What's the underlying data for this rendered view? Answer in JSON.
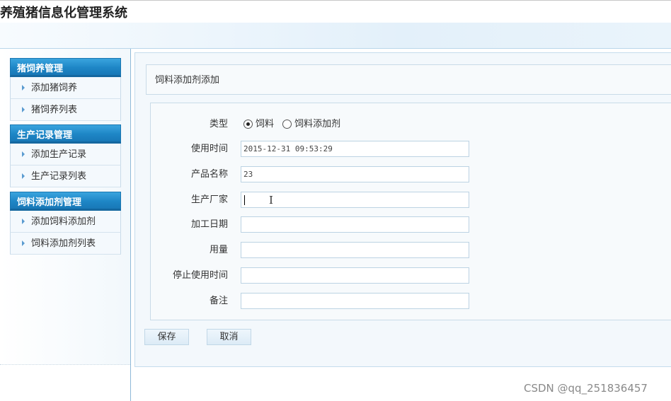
{
  "app": {
    "title": "养殖猪信息化管理系统"
  },
  "sidebar": {
    "groups": [
      {
        "title": "猪饲养管理",
        "items": [
          "添加猪饲养",
          "猪饲养列表"
        ]
      },
      {
        "title": "生产记录管理",
        "items": [
          "添加生产记录",
          "生产记录列表"
        ]
      },
      {
        "title": "饲料添加剂管理",
        "items": [
          "添加饲料添加剂",
          "饲料添加剂列表"
        ]
      }
    ]
  },
  "page": {
    "breadcrumb": "饲料添加剂添加",
    "form": {
      "type_label": "类型",
      "type_options": [
        "饲料",
        "饲料添加剂"
      ],
      "type_selected": "饲料",
      "use_time_label": "使用时间",
      "use_time_value": "2015-12-31 09:53:29",
      "product_name_label": "产品名称",
      "product_name_value": "23",
      "manufacturer_label": "生产厂家",
      "manufacturer_value": "",
      "process_date_label": "加工日期",
      "process_date_value": "",
      "amount_label": "用量",
      "amount_value": "",
      "stop_time_label": "停止使用时间",
      "stop_time_value": "",
      "remark_label": "备注",
      "remark_value": ""
    },
    "buttons": {
      "save": "保存",
      "cancel": "取消"
    }
  },
  "watermark": "CSDN @qq_251836457",
  "colors": {
    "menu_head": "#1e86c6",
    "panel_bg": "#f3f8fc",
    "border": "#c5dcec"
  }
}
